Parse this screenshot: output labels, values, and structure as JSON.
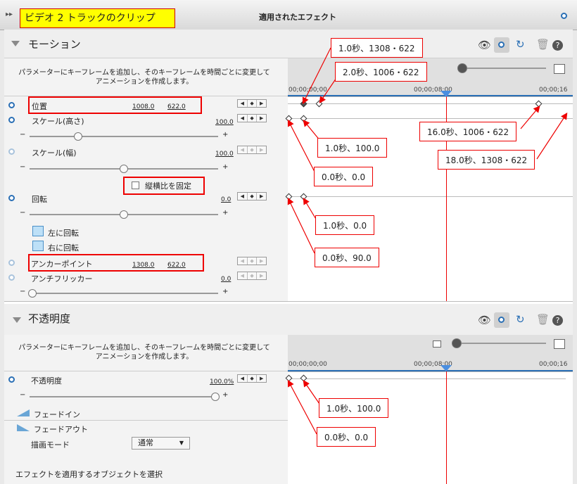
{
  "header": {
    "clip_label": "ビデオ 2 トラックのクリップ",
    "title": "適用されたエフェクト"
  },
  "motion": {
    "title": "モーション",
    "description_line1": "パラメーターにキーフレームを追加し、そのキーフレームを時間ごとに変更して",
    "description_line2": "アニメーションを作成します。",
    "position": {
      "label": "位置",
      "x": "1008.0",
      "y": "622.0"
    },
    "scale_height": {
      "label": "スケール(高さ)",
      "value": "100.0",
      "level": 0.45
    },
    "scale_width": {
      "label": "スケール(幅)",
      "value": "100.0",
      "level": 0.45
    },
    "lock_aspect": {
      "label": "縦横比を固定",
      "checked": false
    },
    "rotation": {
      "label": "回転",
      "value": "0.0",
      "level": 0.5
    },
    "rotate_left": "左に回転",
    "rotate_right": "右に回転",
    "anchor": {
      "label": "アンカーポイント",
      "x": "1308.0",
      "y": "622.0"
    },
    "antiflicker": {
      "label": "アンチフリッカー",
      "value": "0.0",
      "level": 0
    }
  },
  "opacity": {
    "title": "不透明度",
    "description_line1": "パラメーターにキーフレームを追加し、そのキーフレームを時間ごとに変更して",
    "description_line2": "アニメーションを作成します。",
    "opacity": {
      "label": "不透明度",
      "value": "100.0",
      "unit": "%",
      "level": 1.0
    },
    "fade_in": "フェードイン",
    "fade_out": "フェードアウト",
    "blend_mode_label": "描画モード",
    "blend_mode_value": "通常"
  },
  "footer_text": "エフェクトを適用するオブジェクトを選択",
  "timeline": {
    "tick0": "00;00;00;00",
    "tick8": "00;00;08;00",
    "tick16": "00;00;16"
  },
  "annotations": {
    "a1": "1.0秒、1308・622",
    "a2": "2.0秒、1006・622",
    "a3": "16.0秒、1006・622",
    "a4": "18.0秒、1308・622",
    "a5": "1.0秒、100.0",
    "a6": "0.0秒、0.0",
    "a7": "1.0秒、0.0",
    "a8": "0.0秒、90.0",
    "a9": "1.0秒、100.0",
    "a10": "0.0秒、0.0"
  },
  "colors": {
    "accent_red": "#e00000",
    "highlight_yellow": "#ffff00",
    "stopwatch_blue": "#2a6fb5",
    "playhead_red": "#e00000"
  },
  "icons": [
    "expand-arrows-icon",
    "stopwatch-icon",
    "eye-icon",
    "reset-icon",
    "trash-icon",
    "help-icon",
    "triangle-down-icon",
    "fade-in-icon",
    "fade-out-icon",
    "rotate-left-icon",
    "rotate-right-icon",
    "playhead-icon"
  ]
}
